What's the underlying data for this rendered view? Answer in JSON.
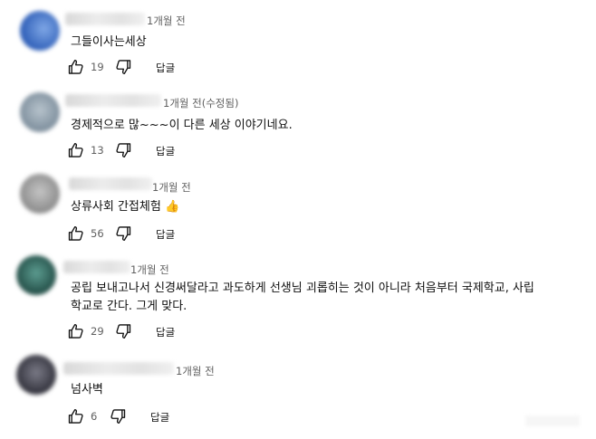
{
  "comments": [
    {
      "time": "1개월 전",
      "text": "그들이사는세상",
      "likes": "19",
      "reply_label": "답글",
      "avatar_color": "#3f74c9"
    },
    {
      "time": "1개월 전(수정됨)",
      "text": "경제적으로 많~~~이 다른 세상 이야기네요.",
      "likes": "13",
      "reply_label": "답글",
      "avatar_color": "#8a9cab"
    },
    {
      "time": "1개월 전",
      "text": "상류사회 간접체험 👍",
      "likes": "56",
      "reply_label": "답글",
      "avatar_color": "#9a9a9a"
    },
    {
      "time": "1개월 전",
      "text_lines": [
        "공립 보내고나서 신경써달라고 과도하게 선생님 괴롭히는 것이 아니라  처음부터 국제학교, 사립",
        "학교로 간다. 그게 맞다."
      ],
      "likes": "29",
      "reply_label": "답글",
      "avatar_color": "#2f6b62"
    },
    {
      "time": "1개월 전",
      "text": "넘사벽",
      "likes": "6",
      "reply_label": "답글",
      "avatar_color": "#4a4a55"
    }
  ],
  "icons": {
    "like": "thumb-up-outline-icon",
    "dislike": "thumb-down-outline-icon"
  }
}
